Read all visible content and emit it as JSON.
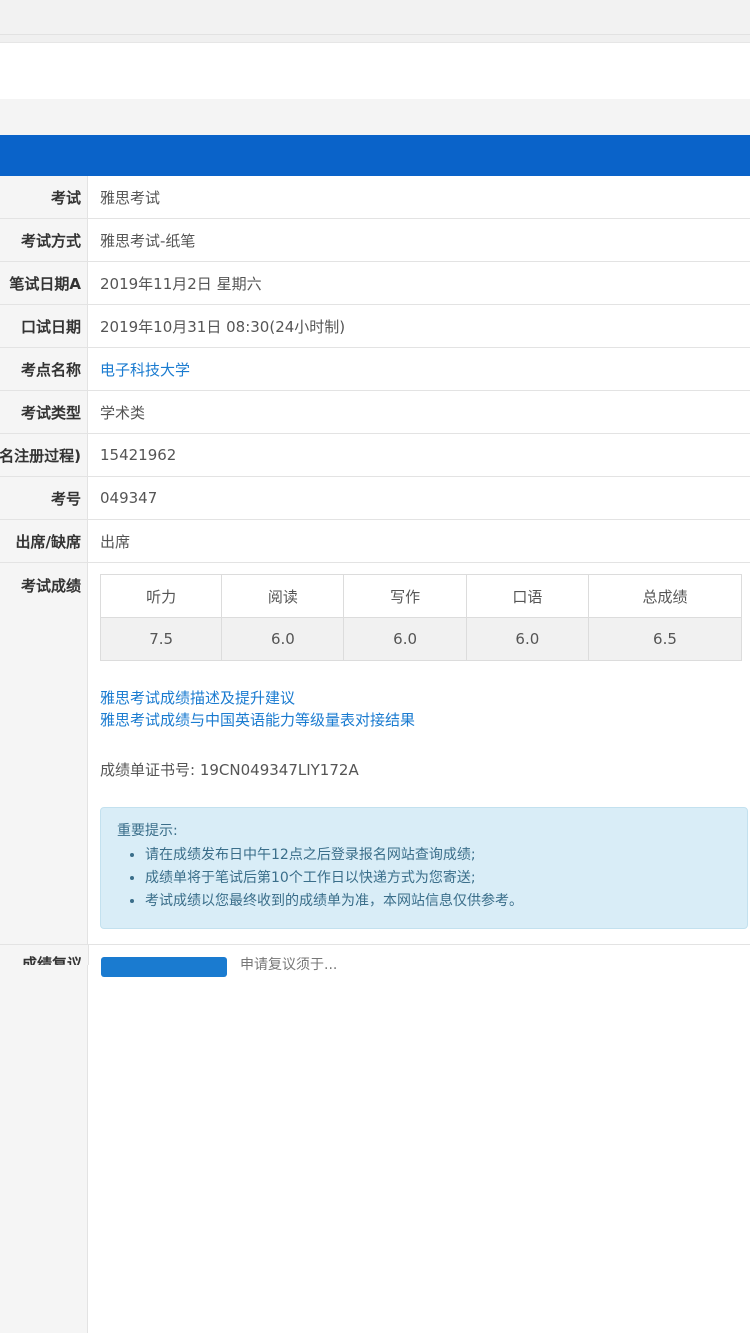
{
  "rows": [
    {
      "label": "考试",
      "value": "雅思考试"
    },
    {
      "label": "考试方式",
      "value": "雅思考试-纸笔"
    },
    {
      "label": "笔试日期A",
      "value": "2019年11月2日 星期六"
    },
    {
      "label": "口试日期",
      "value": "2019年10月31日 08:30(24小时制)"
    },
    {
      "label": "考点名称",
      "value": "电子科技大学"
    },
    {
      "label": "考试类型",
      "value": "学术类"
    },
    {
      "label": "名注册过程)",
      "value": "15421962"
    },
    {
      "label": "考号",
      "value": "049347"
    },
    {
      "label": "出席/缺席",
      "value": "出席"
    }
  ],
  "score_section": {
    "label": "考试成绩",
    "headers": [
      "听力",
      "阅读",
      "写作",
      "口语",
      "总成绩"
    ],
    "values": [
      "7.5",
      "6.0",
      "6.0",
      "6.0",
      "6.5"
    ],
    "links": [
      "雅思考试成绩描述及提升建议",
      "雅思考试成绩与中国英语能力等级量表对接结果"
    ],
    "certificate": "成绩单证书号: 19CN049347LIY172A",
    "notice": {
      "title": "重要提示:",
      "items": [
        "请在成绩发布日中午12点之后登录报名网站查询成绩;",
        "成绩单将于笔试后第10个工作日以快递方式为您寄送;",
        "考试成绩以您最终收到的成绩单为准，本网站信息仅供参考。"
      ]
    }
  },
  "bottom": {
    "label": "成绩复议",
    "text": "申请复议须于..."
  },
  "colors": {
    "primary": "#0a63c9",
    "link": "#1a7bd0",
    "notice_bg": "#d9edf7"
  }
}
